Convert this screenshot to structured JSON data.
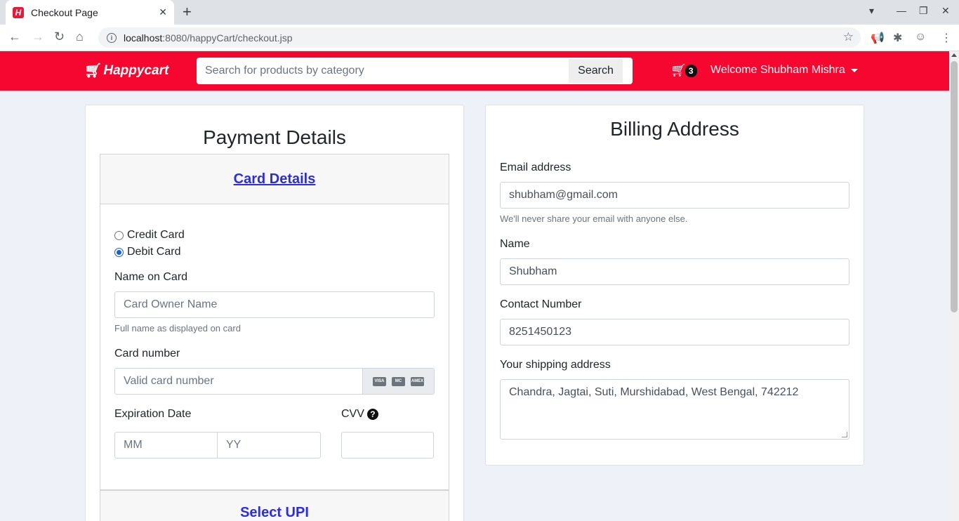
{
  "browser": {
    "tab_title": "Checkout Page",
    "favicon_letter": "H",
    "url_host": "localhost",
    "url_path": ":8080/happyCart/checkout.jsp"
  },
  "navbar": {
    "brand": "Happycart",
    "search_placeholder": "Search for products by category",
    "search_button": "Search",
    "cart_count": "3",
    "welcome": "Welcome Shubham Mishra",
    "accent_color": "#f6072f"
  },
  "payment": {
    "heading": "Payment Details",
    "card_section_title": "Card Details",
    "card_types": [
      {
        "label": "Credit Card",
        "checked": false
      },
      {
        "label": "Debit Card",
        "checked": true
      }
    ],
    "name_label": "Name on Card",
    "name_placeholder": "Card Owner Name",
    "name_help": "Full name as displayed on card",
    "number_label": "Card number",
    "number_placeholder": "Valid card number",
    "card_brands": [
      "VISA",
      "MC",
      "AMEX"
    ],
    "expiry_label": "Expiration Date",
    "month_placeholder": "MM",
    "year_placeholder": "YY",
    "cvv_label": "CVV",
    "upi_section_title": "Select UPI"
  },
  "billing": {
    "heading": "Billing Address",
    "email_label": "Email address",
    "email_value": "shubham@gmail.com",
    "email_help": "We'll never share your email with anyone else.",
    "name_label": "Name",
    "name_value": "Shubham",
    "contact_label": "Contact Number",
    "contact_value": "8251450123",
    "address_label": "Your shipping address",
    "address_value": "Chandra, Jagtai, Suti, Murshidabad, West Bengal, 742212"
  }
}
